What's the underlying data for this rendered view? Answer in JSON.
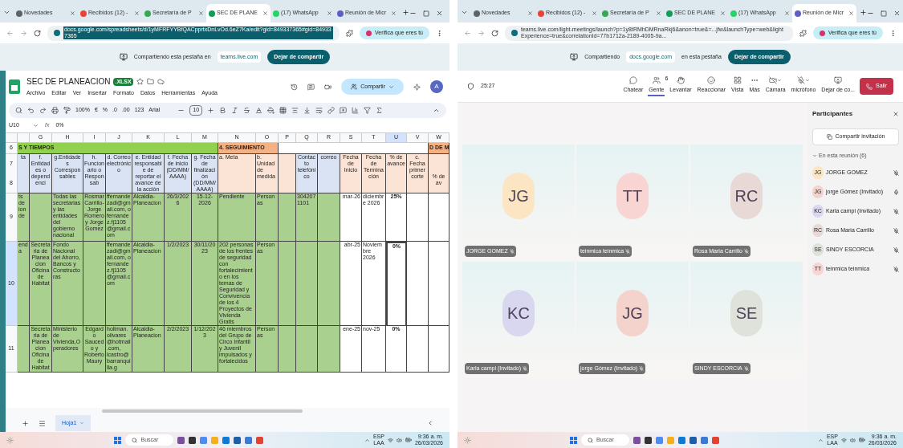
{
  "left": {
    "tabs": [
      {
        "kind": "news",
        "label": "Novedades",
        "selected": false
      },
      {
        "kind": "mail",
        "label": "Recibidos (12) -",
        "selected": false
      },
      {
        "kind": "drive",
        "label": "Secretaría de P",
        "selected": false
      },
      {
        "kind": "sheets",
        "label": "SEC DE PLANE",
        "selected": true
      },
      {
        "kind": "whatsapp",
        "label": "(17) WhatsApp",
        "selected": false
      },
      {
        "kind": "teams",
        "label": "Reunión de Micr",
        "selected": false
      }
    ],
    "address": "docs.google.com/spreadsheets/d/1yMFRFYYBfQACpprtxDnLvOd.6eZ7Ka/edit?gid=849337365#gid=849337365",
    "profile": "Verifica que eres tú",
    "share_banner": {
      "before": "Compartiendo esta pestaña en",
      "site": "teams.live.com",
      "button": "Dejar de compartir"
    },
    "sheet": {
      "title": "SEC DE PLANEACION",
      "badge": ".XLSX",
      "menus": [
        "Archivo",
        "Editar",
        "Ver",
        "Insertar",
        "Formato",
        "Datos",
        "Herramientas",
        "Ayuda"
      ],
      "share_button": "Compartir",
      "avatar": "A",
      "toolbar": {
        "zoom": "100%",
        "currency": "€",
        "percent": "%",
        "decrease_decimals": ".0",
        "increase_decimals": ".00",
        "number_format": "123",
        "font": "Arial",
        "font_size": "10"
      },
      "formula_bar": {
        "cell": "U10",
        "fx": "fx",
        "value": "0%"
      },
      "bands_row": "6",
      "bands": [
        {
          "text": "S Y TIEMPOS",
          "color": "#92d050",
          "columns": [
            {
              "letter": "G",
              "selected": false
            },
            {
              "letter": "H",
              "selected": false
            },
            {
              "letter": "I",
              "selected": false
            },
            {
              "letter": "J",
              "selected": false
            },
            {
              "letter": "K",
              "selected": false
            },
            {
              "letter": "L",
              "selected": false
            },
            {
              "letter": "M",
              "selected": false
            }
          ]
        },
        {
          "text": "4. SEGUIMIENTO",
          "color": "#f4b183",
          "columns": [
            {
              "letter": "N",
              "selected": false
            },
            {
              "letter": "O",
              "selected": false
            }
          ]
        },
        {
          "color": "#ffffff",
          "columns": [
            {
              "letter": "P",
              "selected": false
            },
            {
              "letter": "Q",
              "selected": false
            },
            {
              "letter": "R",
              "selected": false
            },
            {
              "letter": "S",
              "selected": false
            },
            {
              "letter": "T",
              "selected": false
            },
            {
              "letter": "U",
              "selected": true
            },
            {
              "letter": "V",
              "selected": false
            }
          ]
        },
        {
          "text": "D DE M",
          "color": "#f4b183",
          "columns": [
            {
              "letter": "W",
              "selected": false
            }
          ]
        }
      ],
      "header": {
        "numbers": [
          "7",
          "8"
        ],
        "cells": [
          {
            "text": "ta",
            "color": "#dae3f3"
          },
          {
            "text": "f. Entidades o dependenci",
            "color": "#dae3f3"
          },
          {
            "text": "g.Entidades Corresponsables",
            "color": "#dae3f3"
          },
          {
            "text": "h. Funcionario o Responsab",
            "color": "#dae3f3"
          },
          {
            "text": "d. Correo electrónico",
            "color": "#dae3f3"
          },
          {
            "text": "e. Entidad responsable de reportar el avance de la acción",
            "color": "#dae3f3"
          },
          {
            "text": "f. Fecha de inicio (DD/MM/AAAA)",
            "color": "#dae3f3"
          },
          {
            "text": "g. Fecha de finalización (DD/MM/AAAA)",
            "color": "#dae3f3"
          },
          {
            "text": "a. Meta",
            "color": "#fbe4d5"
          },
          {
            "text": "b. Unidad de medida",
            "color": "#fbe4d5"
          },
          {
            "color": "#fbe4d5"
          },
          {
            "text": "Contacto telefónico",
            "color": "#dae3f3"
          },
          {
            "text": "correo",
            "color": "#dae3f3"
          },
          {
            "text": "Fecha de Inicio",
            "color": "#fbe4d5"
          },
          {
            "text": "Fecha de Terminación",
            "color": "#fbe4d5"
          },
          {
            "text": "% de avance",
            "color": "#fbe4d5"
          },
          {
            "text": "c. Fecha primer corte",
            "color": "#fbe4d5"
          },
          {
            "text": "% de av",
            "color": "#fbe4d5"
          }
        ]
      },
      "rows": [
        {
          "number": "9",
          "selected": false,
          "cells": [
            {
              "text": "ts de ion de",
              "color": "#a9d08e"
            },
            {
              "color": "#a9d08e"
            },
            {
              "text": "Todas las secretarias y las entidades del gobierno nacional",
              "color": "#a9d08e"
            },
            {
              "text": "Rosmar Carrillo-Jorge Romero y Jorge Gomez",
              "color": "#a9d08e"
            },
            {
              "text": "ffernandezadi@gmail.com, o fernandez.fj1105@gmail.com",
              "color": "#a9d08e"
            },
            {
              "text": "Alcaldia-Planeacion",
              "color": "#a9d08e"
            },
            {
              "text": "26/3/2026",
              "color": "#a9d08e"
            },
            {
              "text": "15-12-2026",
              "color": "#a9d08e"
            },
            {
              "text": "Pendiente",
              "color": "#a9d08e"
            },
            {
              "text": "Personas",
              "color": "#a9d08e"
            },
            {
              "color": "#a9d08e"
            },
            {
              "text": "3042071101",
              "color": "#a9d08e"
            },
            {
              "color": "#a9d08e"
            },
            {
              "text": "mar-26",
              "color": "#ffffff"
            },
            {
              "text": "diciembre 2026",
              "color": "#ffffff"
            },
            {
              "text": "25%",
              "color": "#ffffff"
            },
            {
              "color": "#ffffff"
            },
            {
              "color": "#ffffff"
            }
          ]
        },
        {
          "number": "10",
          "selected": true,
          "cells": [
            {
              "text": "enda",
              "color": "#a9d08e"
            },
            {
              "text": "Secretaria de Planeacion Oficina de Habitat",
              "color": "#a9d08e"
            },
            {
              "text": "Fondo Nacional del Ahorro, Bancos y Constructoras",
              "color": "#a9d08e"
            },
            {
              "color": "#a9d08e"
            },
            {
              "text": "ffernandezadi@gmail.com, o fernandez.fj1105@gmail.com",
              "color": "#a9d08e"
            },
            {
              "text": "Alcaldia-Planeacion",
              "color": "#a9d08e"
            },
            {
              "text": "1/2/2023",
              "color": "#a9d08e"
            },
            {
              "text": "30/11/2023",
              "color": "#a9d08e"
            },
            {
              "text": "202 personas de los frentes de seguridad con fortalecimiento en los temas de Seguridad y Convivencia de los 4 Proyectos de Vivienda Gratis",
              "color": "#a9d08e"
            },
            {
              "text": "Personas",
              "color": "#a9d08e"
            },
            {
              "color": "#a9d08e"
            },
            {
              "color": "#a9d08e"
            },
            {
              "color": "#a9d08e"
            },
            {
              "text": "abr-25",
              "color": "#ffffff"
            },
            {
              "text": "Noviembre 2026",
              "color": "#ffffff"
            },
            {
              "text": "0%",
              "color": "#ffffff"
            },
            {
              "color": "#ffffff"
            },
            {
              "color": "#ffffff"
            }
          ]
        },
        {
          "number": "11",
          "selected": false,
          "cells": [
            {
              "color": "#a9d08e"
            },
            {
              "text": "Secretaria de Planeacion Oficina de Habitat",
              "color": "#a9d08e"
            },
            {
              "text": "Ministerio de Vivienda,Operadores",
              "color": "#a9d08e"
            },
            {
              "text": "Edgardo Saucedo y Roberto Maury",
              "color": "#a9d08e"
            },
            {
              "text": "hollman.olivares@hotmail.com, lcastro@barranquilla.g",
              "color": "#a9d08e"
            },
            {
              "text": "Alcaldia-Planeacion",
              "color": "#a9d08e"
            },
            {
              "text": "2/2/2023",
              "color": "#a9d08e"
            },
            {
              "text": "1/12/2023",
              "color": "#a9d08e"
            },
            {
              "text": "46 miembros del Grupo de Circo Infantil y Juvenil impulsados y fortalecidos",
              "color": "#a9d08e"
            },
            {
              "text": "Personas",
              "color": "#a9d08e"
            },
            {
              "color": "#a9d08e"
            },
            {
              "color": "#a9d08e"
            },
            {
              "color": "#a9d08e"
            },
            {
              "text": "ene-25",
              "color": "#ffffff"
            },
            {
              "text": "nov-25",
              "color": "#ffffff"
            },
            {
              "text": "0%",
              "color": "#ffffff"
            },
            {
              "color": "#ffffff"
            },
            {
              "color": "#ffffff"
            }
          ]
        }
      ],
      "sheet_tabs": [
        {
          "label": "Hoja1",
          "selected": true
        }
      ]
    },
    "taskbar": {
      "search": "Buscar",
      "language": "ESP",
      "layout": "LAA",
      "time": "9:36 a. m.",
      "date": "26/03/2026"
    }
  },
  "right": {
    "tabs": [
      {
        "kind": "news",
        "label": "Novedades",
        "selected": false
      },
      {
        "kind": "mail",
        "label": "Recibidos (12) -",
        "selected": false
      },
      {
        "kind": "drive",
        "label": "Secretaría de P",
        "selected": false
      },
      {
        "kind": "sheets",
        "label": "SEC DE PLANE",
        "selected": false
      },
      {
        "kind": "whatsapp",
        "label": "(17) WhatsApp",
        "selected": false
      },
      {
        "kind": "teams",
        "label": "Reunión de Micr",
        "selected": true
      }
    ],
    "address": "teams.live.com/light-meetings/launch?p=1y8tRMhDMRnaRkj6&anon=true&=...jfw&launchType=web&lightExperience=true&correlationId=77b1712a-2189-4005-9a...",
    "profile": "Verifica que eres tú",
    "share_banner": {
      "before": "Compartiendo",
      "site": "docs.google.com",
      "after": "en esta pestaña",
      "button": "Dejar de compartir"
    },
    "meeting": {
      "timer": "25:27",
      "actions": [
        {
          "kind": "chat",
          "label": "Chatear",
          "selected": false
        },
        {
          "kind": "people",
          "label": "Gente",
          "selected": true,
          "badge": "6"
        },
        {
          "kind": "hand",
          "label": "Levantar",
          "selected": false
        },
        {
          "kind": "react",
          "label": "Reaccionar",
          "selected": false
        },
        {
          "kind": "view",
          "label": "Vista",
          "selected": false
        },
        {
          "kind": "more",
          "label": "Más",
          "selected": false
        },
        {
          "kind": "camera",
          "label": "Cámara",
          "selected": false
        },
        {
          "kind": "mic",
          "label": "micrófono",
          "selected": false
        },
        {
          "kind": "stop",
          "label": "Dejar de co...",
          "selected": false
        }
      ],
      "leave": "Salir"
    },
    "tiles": [
      {
        "initials": "JG",
        "name": "JORGE GOMEZ",
        "color": "#fbe5c2"
      },
      {
        "initials": "TT",
        "name": "teinmica teinmica",
        "color": "#f8d4d2"
      },
      {
        "initials": "RC",
        "name": "Rosa Maria Carrillo",
        "color": "#e9d9d6"
      },
      {
        "initials": "KC",
        "name": "Karla campi (Invitado)",
        "color": "#d9d6f0"
      },
      {
        "initials": "JG",
        "name": "jorge Gómez (Invitado)",
        "color": "#f3d3cc"
      },
      {
        "initials": "SE",
        "name": "SINDY ESCORCIA",
        "color": "#dee2da"
      }
    ],
    "panel": {
      "title": "Participantes",
      "invite": "Compartir invitación",
      "section": "En esta reunión (6)",
      "expanded": true,
      "participants": [
        {
          "initials": "JG",
          "name": "JORGE GOMEZ",
          "color": "#fbe5c2",
          "muted": true
        },
        {
          "initials": "JG",
          "name": "jorge Gómez (Invitado)",
          "color": "#f3d3cc",
          "muted": false
        },
        {
          "initials": "KC",
          "name": "Karla campi (Invitado)",
          "color": "#d9d6f0",
          "muted": true
        },
        {
          "initials": "RC",
          "name": "Rosa Maria Carrillo",
          "color": "#e9d9d6",
          "muted": true
        },
        {
          "initials": "SE",
          "name": "SINDY ESCORCIA",
          "color": "#dee2da",
          "muted": true
        },
        {
          "initials": "TT",
          "name": "teinmica teinmica",
          "color": "#f8d4d2",
          "muted": true
        }
      ]
    },
    "taskbar": {
      "search": "Buscar",
      "language": "ESP",
      "layout": "LAA",
      "time": "9:36 a. m.",
      "date": "26/03/2026"
    }
  }
}
